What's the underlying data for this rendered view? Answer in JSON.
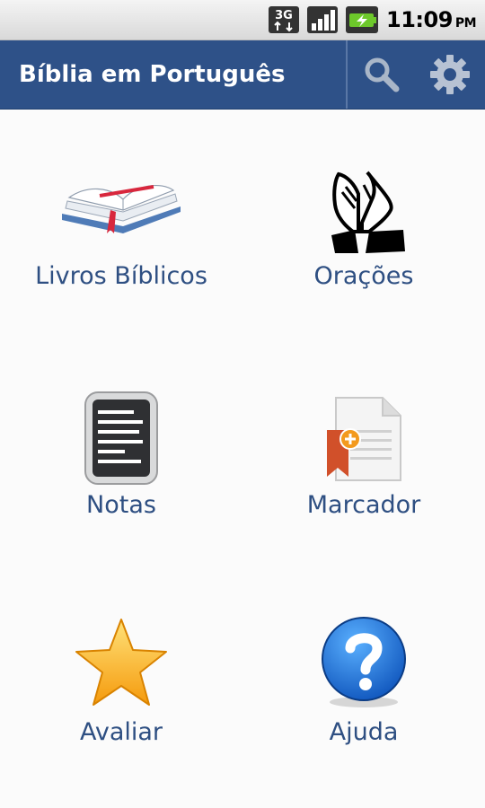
{
  "status_bar": {
    "network": "3G",
    "time": "11:09",
    "ampm": "PM"
  },
  "action_bar": {
    "title": "Bíblia em Português",
    "icons": [
      "search-icon",
      "settings-gear-icon"
    ]
  },
  "menu": [
    {
      "label": "Livros Bíblicos",
      "icon": "open-bible-icon"
    },
    {
      "label": "Orações",
      "icon": "praying-hands-icon"
    },
    {
      "label": "Notas",
      "icon": "notes-icon"
    },
    {
      "label": "Marcador",
      "icon": "bookmark-icon"
    },
    {
      "label": "Avaliar",
      "icon": "star-icon"
    },
    {
      "label": "Ajuda",
      "icon": "help-icon"
    }
  ],
  "colors": {
    "action_bar": "#2e5188",
    "label_text": "#2e4f82",
    "background": "#fbfbfb"
  }
}
